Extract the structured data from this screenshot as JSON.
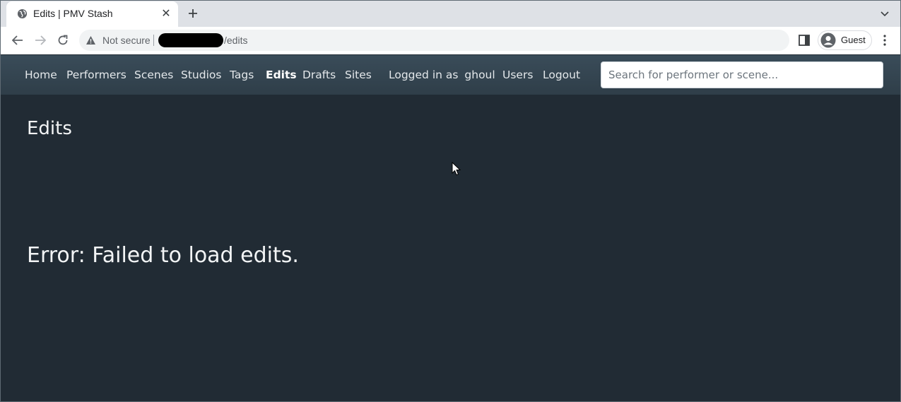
{
  "browser": {
    "tab": {
      "title": "Edits | PMV Stash"
    },
    "omnibox": {
      "security_label": "Not secure",
      "url_path": "/edits"
    },
    "profile": {
      "label": "Guest"
    }
  },
  "navbar": {
    "links": [
      {
        "label": "Home"
      },
      {
        "label": "Performers"
      },
      {
        "label": "Scenes"
      },
      {
        "label": "Studios"
      },
      {
        "label": "Tags"
      },
      {
        "label": "Edits",
        "active": true
      },
      {
        "label": "Drafts"
      },
      {
        "label": "Sites"
      }
    ],
    "logged_in_prefix": "Logged in as",
    "username": "ghoul",
    "users_label": "Users",
    "logout_label": "Logout",
    "search_placeholder": "Search for performer or scene..."
  },
  "page": {
    "title": "Edits",
    "error": "Error: Failed to load edits."
  }
}
